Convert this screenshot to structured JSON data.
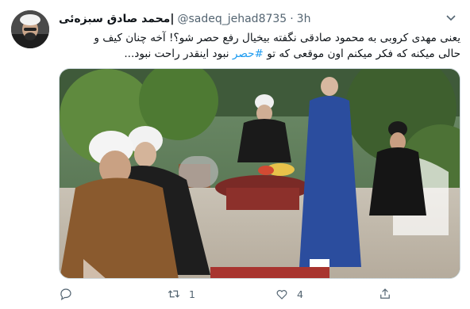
{
  "tweet": {
    "display_name": "محمد صادق سبزه‌ئی|",
    "handle": "@sadeq_jehad8735",
    "separator": "·",
    "time": "3h",
    "text_line_1": "یعنی مهدی کروبی به محمود صادقی نگفته بیخیال رفع حصر شو؟! آخه چنان کیف و",
    "text_line_2_before": "حالی میکنه که فکر میکنم اون موقعی که تو ",
    "hashtag": "#حصر",
    "text_line_2_after": " نبود اینقدر راحت نبود..."
  },
  "actions": {
    "reply_count": "",
    "retweet_count": "1",
    "like_count": "4"
  },
  "icons": [
    "chevron-down-icon",
    "reply-icon",
    "retweet-icon",
    "like-icon",
    "share-icon"
  ],
  "colors": {
    "accent": "#1d9bf0",
    "secondary_text": "#536471"
  }
}
